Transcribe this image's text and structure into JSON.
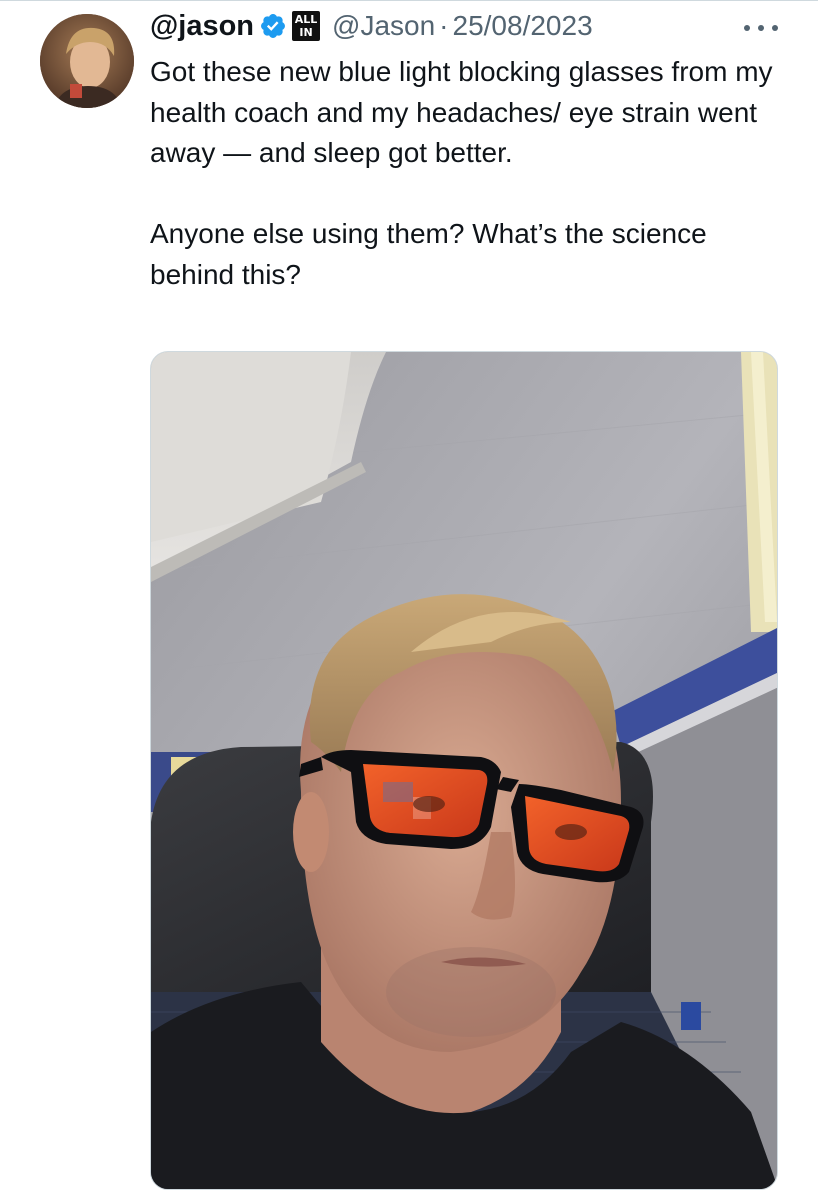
{
  "tweet": {
    "display_name": "@jason",
    "affiliate_badge": [
      "ALL",
      "IN"
    ],
    "handle": "@Jason",
    "separator": "·",
    "date": "25/08/2023",
    "text": "Got these new blue light blocking glasses from my health coach and my headaches/ eye strain went away — and sleep got better.\n\nAnyone else using them? What’s the science behind this?"
  },
  "icons": {
    "verified": "verified-check-icon",
    "more": "more-horizontal-icon"
  },
  "colors": {
    "verified_blue": "#1d9bf0",
    "secondary_text": "#536471",
    "primary_text": "#0f1419",
    "lens_orange": "#e8521f"
  }
}
